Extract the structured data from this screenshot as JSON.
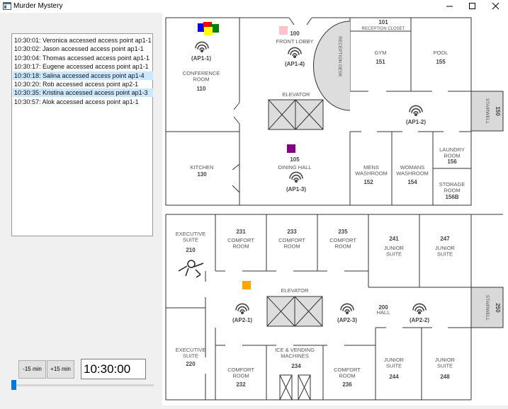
{
  "window": {
    "title": "Murder Mystery",
    "minimize_label": "—",
    "maximize_label": "☐",
    "close_label": "✕"
  },
  "log": {
    "entries": [
      {
        "text": "10:30:01: Veronica accessed access point ap1-1",
        "highlighted": false
      },
      {
        "text": "10:30:02: Jason accessed access point ap1-1",
        "highlighted": false
      },
      {
        "text": "10:30:04: Thomas accessed access point ap1-1",
        "highlighted": false
      },
      {
        "text": "10:30:17: Eugene accessed access point ap1-1",
        "highlighted": false
      },
      {
        "text": "10:30:18: Salina accessed access point ap1-4",
        "highlighted": true
      },
      {
        "text": "10:30:20: Rob accessed access point ap2-1",
        "highlighted": false
      },
      {
        "text": "10:30:35: Kristina accessed access point ap1-3",
        "highlighted": true
      },
      {
        "text": "10:30:57: Alok accessed access point ap1-1",
        "highlighted": false
      }
    ]
  },
  "controls": {
    "minus_label": "-15 min",
    "plus_label": "+15 min",
    "time_value": "10:30:00",
    "slider_fraction": 0.0
  },
  "map": {
    "floor1": {
      "rooms": {
        "conference_name": "CONFERENCE\nROOM",
        "conference_num": "110",
        "ap1_1": "(AP1-1)",
        "front_lobby_num": "100",
        "front_lobby_name": "FRONT LOBBY",
        "ap1_4": "(AP1-4)",
        "reception_desk": "RECEPTION DESK",
        "reception_closet_num": "101",
        "reception_closet_name": "RECEPTION CLOSET",
        "gym_name": "GYM",
        "gym_num": "151",
        "pool_name": "POOL",
        "pool_num": "155",
        "stairwell_name": "STAIRWELL",
        "stairwell_num": "150",
        "elevator": "ELEVATOR",
        "ap1_2": "(AP1-2)",
        "kitchen_name": "KITCHEN",
        "kitchen_num": "130",
        "dining_num": "105",
        "dining_name": "DINING HALL",
        "ap1_3": "(AP1-3)",
        "mens_name": "MENS\nWASHROOM",
        "mens_num": "152",
        "womans_name": "WOMANS\nWASHROOM",
        "womans_num": "154",
        "laundry_name": "LAUNDRY\nROOM",
        "laundry_num": "156",
        "storage_name": "STORAGE\nROOM",
        "storage_num": "156B"
      }
    },
    "floor2": {
      "rooms": {
        "exec210_name": "EXECUTIVE\nSUITE",
        "exec210_num": "210",
        "comfort231_num": "231",
        "comfort231_name": "COMFORT\nROOM",
        "comfort233_num": "233",
        "comfort233_name": "COMFORT\nROOM",
        "comfort235_num": "235",
        "comfort235_name": "COMFORT\nROOM",
        "junior241_num": "241",
        "junior241_name": "JUNIOR\nSUITE",
        "junior247_num": "247",
        "junior247_name": "JUNIOR\nSUITE",
        "elevator": "ELEVATOR",
        "ap2_1": "(AP2-1)",
        "ap2_3": "(AP2-3)",
        "hall_num": "200",
        "hall_name": "HALL",
        "ap2_2": "(AP2-2)",
        "stairwell_name": "STAIRWELL",
        "stairwell_num": "250",
        "exec220_name": "EXECUTIVE\nSUITE",
        "exec220_num": "220",
        "comfort232_name": "COMFORT\nROOM",
        "comfort232_num": "232",
        "ice_name": "ICE & VENDING\nMACHINES",
        "ice_num": "234",
        "comfort236_name": "COMFORT\nROOM",
        "comfort236_num": "236",
        "junior244_name": "JUNIOR\nSUITE",
        "junior244_num": "244",
        "junior248_name": "JUNIOR\nSUITE",
        "junior248_num": "248"
      }
    },
    "markers": [
      {
        "color": "#0000ff",
        "room": "110"
      },
      {
        "color": "#ff0000",
        "room": "110"
      },
      {
        "color": "#008000",
        "room": "110"
      },
      {
        "color": "#ffff00",
        "room": "110"
      },
      {
        "color": "#ffc0cb",
        "room": "100"
      },
      {
        "color": "#800080",
        "room": "105"
      },
      {
        "color": "#ffa500",
        "room": "200"
      }
    ],
    "colors": {
      "wall": "#333333",
      "text": "#555555",
      "stairwell_fill": "#d9d9d9",
      "elevator_fill": "#dddddd"
    }
  }
}
